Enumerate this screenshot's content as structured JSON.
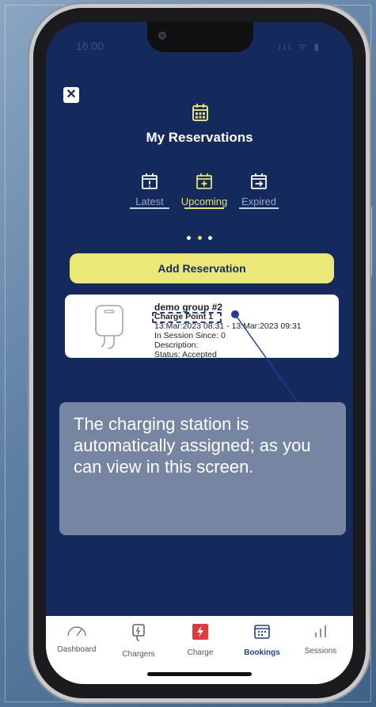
{
  "status_bar": {
    "time": "16:00",
    "icons": "ııl ᯤ ▮"
  },
  "title": "My Reservations",
  "tabs": [
    {
      "label": "Latest",
      "icon": "calendar-alert-icon",
      "active": false
    },
    {
      "label": "Upcoming",
      "icon": "calendar-plus-icon",
      "active": true
    },
    {
      "label": "Expired",
      "icon": "calendar-arrow-icon",
      "active": false
    }
  ],
  "add_reservation_label": "Add Reservation",
  "reservation": {
    "group": "demo group #2",
    "charge_point": "Charge Point 1",
    "time_range": "13:Mar:2023 08:31 - 13:Mar:2023 09:31",
    "session_since": "In Session Since: 0",
    "description": "Description:",
    "status": "Status: Accepted"
  },
  "callout_text": "The charging station is automatically assigned; as you can view in this screen.",
  "bottom_nav": [
    {
      "label": "Dashboard",
      "icon": "speedometer-icon",
      "active": false
    },
    {
      "label": "Chargers",
      "icon": "charger-icon",
      "active": false
    },
    {
      "label": "Charge",
      "icon": "lightning-icon",
      "active": false
    },
    {
      "label": "Bookings",
      "icon": "calendar-icon",
      "active": true
    },
    {
      "label": "Sessions",
      "icon": "bar-chart-icon",
      "active": false
    }
  ],
  "colors": {
    "screen_bg": "#142a5c",
    "accent_yellow": "#ece877",
    "active_blue": "#1f3f98",
    "charge_red": "#e03a3a"
  }
}
